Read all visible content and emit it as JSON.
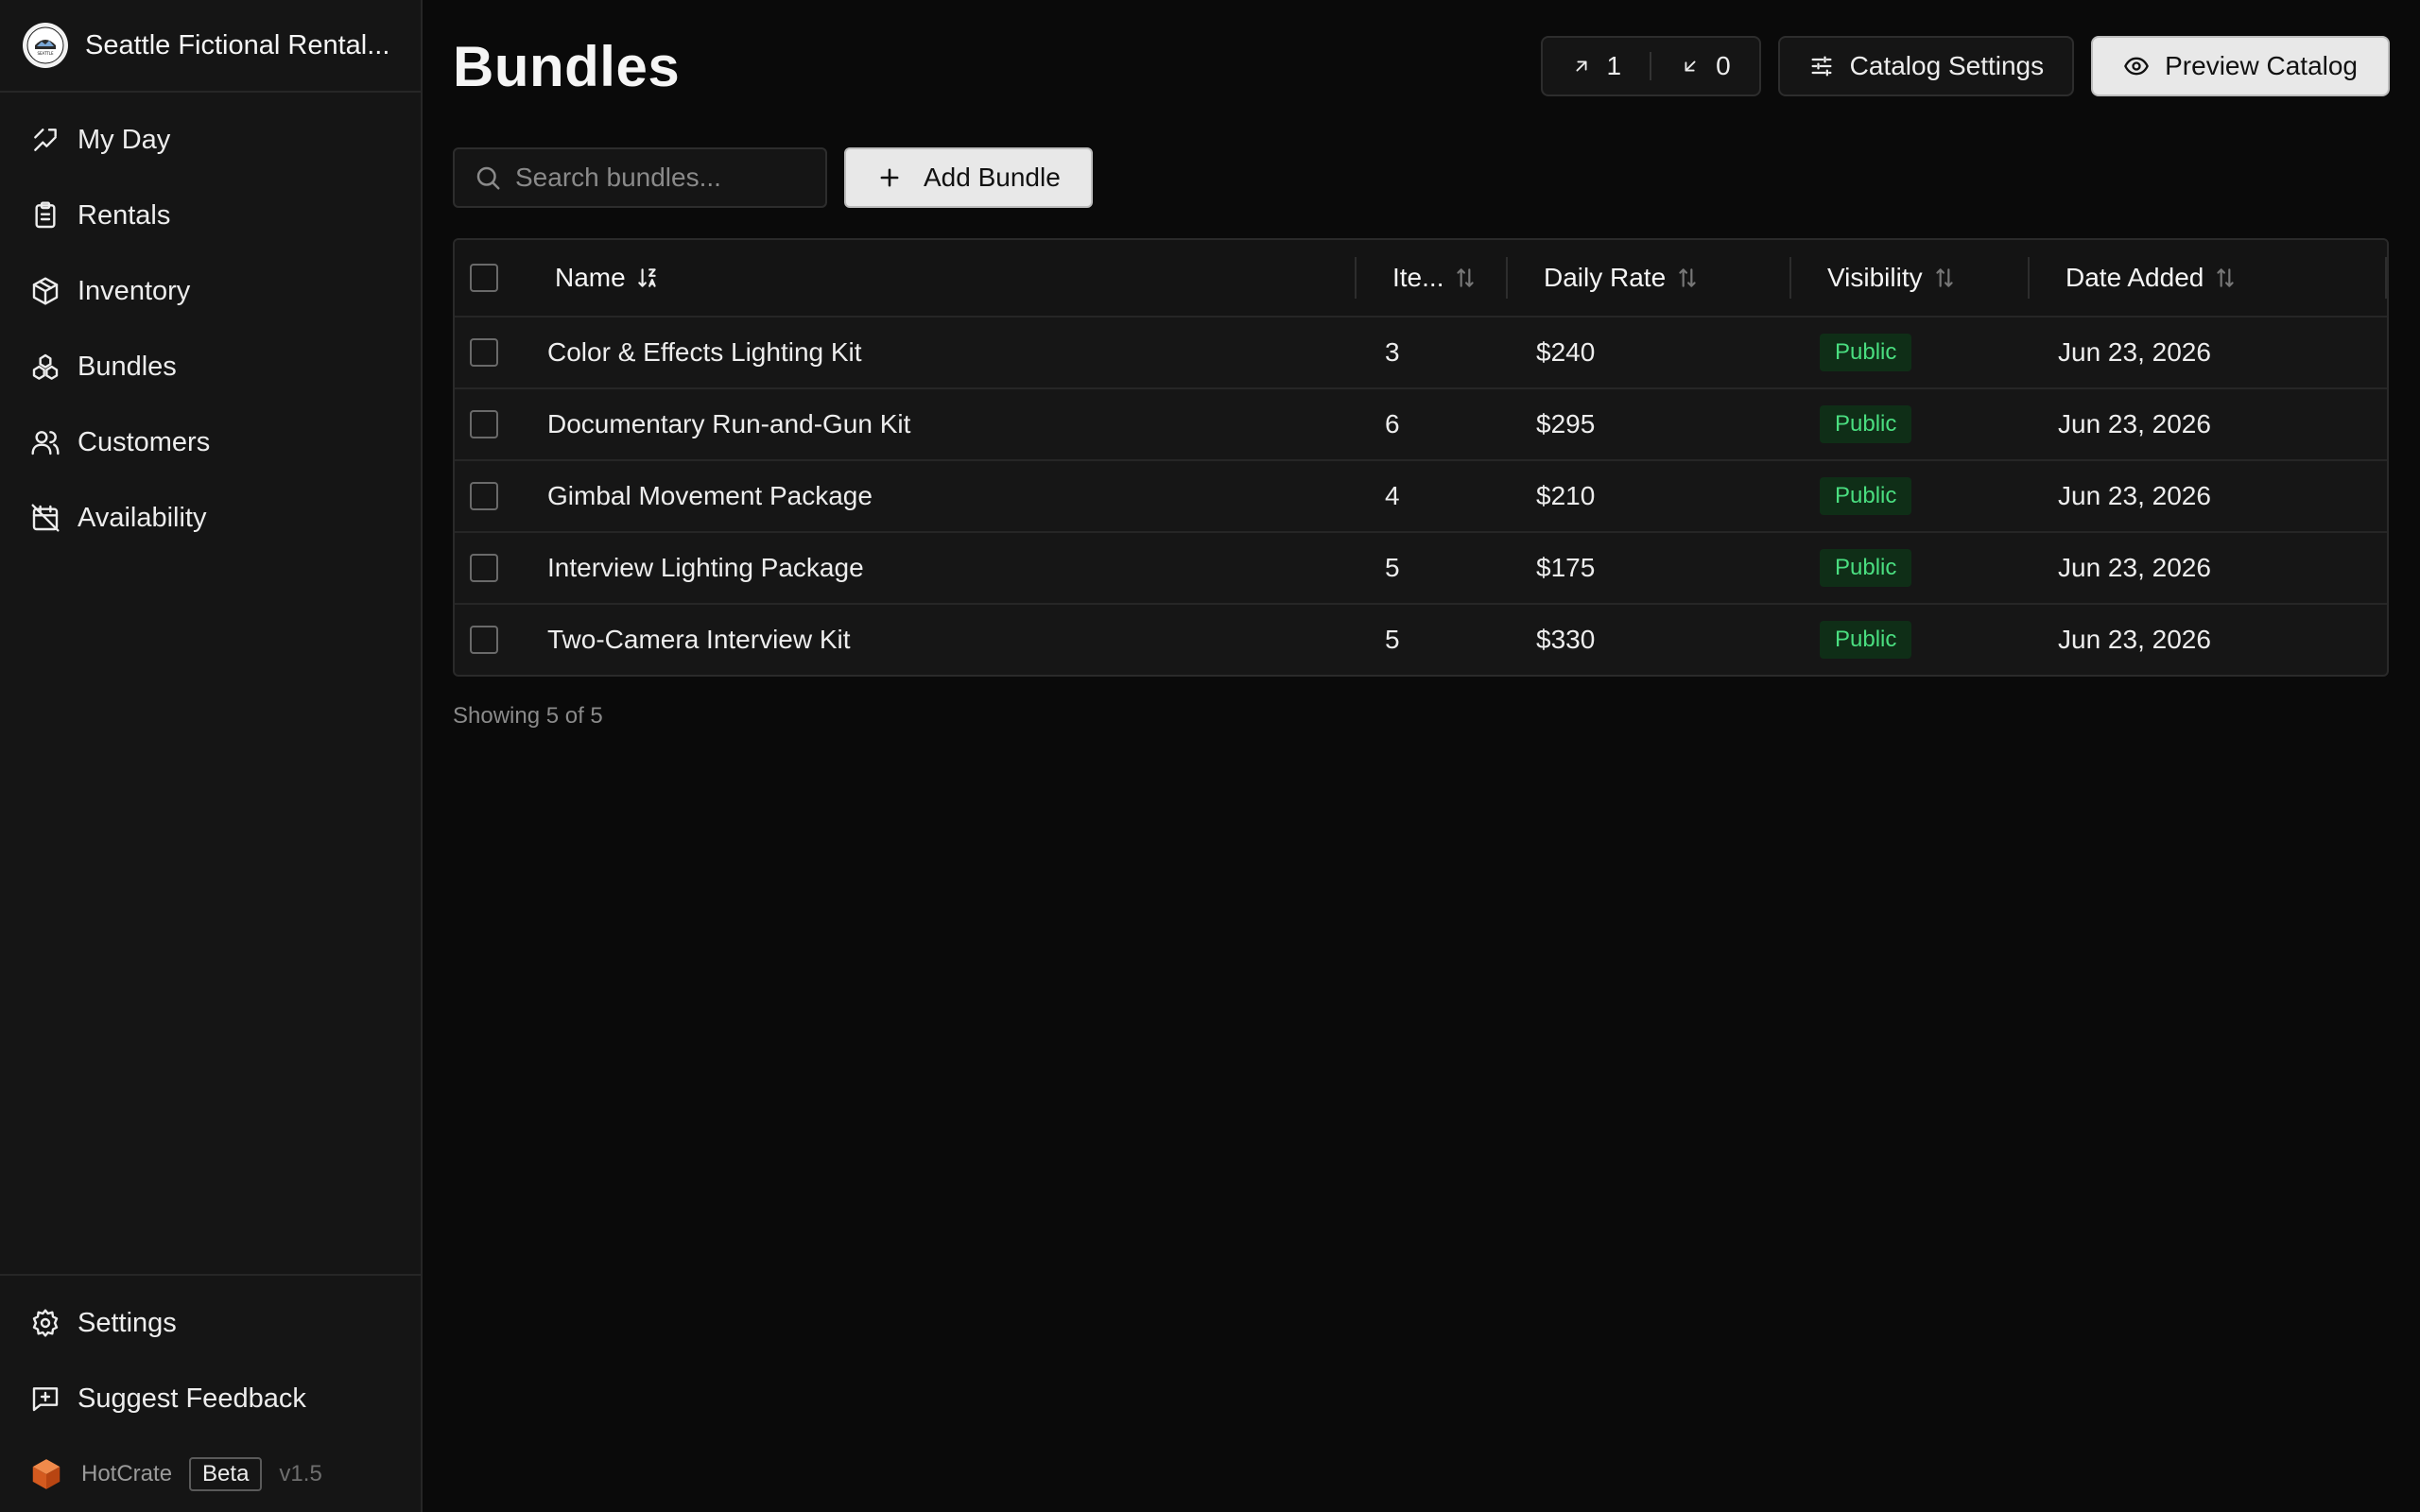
{
  "sidebar": {
    "brand_name": "Seattle Fictional Rental...",
    "logo_text": "SEATTLE",
    "nav": [
      {
        "label": "My Day",
        "icon": "my-day-icon"
      },
      {
        "label": "Rentals",
        "icon": "clipboard-icon"
      },
      {
        "label": "Inventory",
        "icon": "box-icon"
      },
      {
        "label": "Bundles",
        "icon": "bundles-icon"
      },
      {
        "label": "Customers",
        "icon": "users-icon"
      },
      {
        "label": "Availability",
        "icon": "calendar-off-icon"
      }
    ],
    "bottom": [
      {
        "label": "Settings",
        "icon": "gear-icon"
      },
      {
        "label": "Suggest Feedback",
        "icon": "feedback-icon"
      }
    ],
    "footer": {
      "app_name": "HotCrate",
      "beta": "Beta",
      "version": "v1.5"
    }
  },
  "header": {
    "title": "Bundles",
    "outgoing_count": "1",
    "incoming_count": "0",
    "catalog_settings": "Catalog Settings",
    "preview_catalog": "Preview Catalog"
  },
  "toolbar": {
    "search_placeholder": "Search bundles...",
    "add_bundle": "Add Bundle"
  },
  "table": {
    "columns": [
      "Name",
      "Ite...",
      "Daily Rate",
      "Visibility",
      "Date Added"
    ],
    "rows": [
      {
        "name": "Color & Effects Lighting Kit",
        "items": "3",
        "rate": "$240",
        "visibility": "Public",
        "date": "Jun 23, 2026"
      },
      {
        "name": "Documentary Run-and-Gun Kit",
        "items": "6",
        "rate": "$295",
        "visibility": "Public",
        "date": "Jun 23, 2026"
      },
      {
        "name": "Gimbal Movement Package",
        "items": "4",
        "rate": "$210",
        "visibility": "Public",
        "date": "Jun 23, 2026"
      },
      {
        "name": "Interview Lighting Package",
        "items": "5",
        "rate": "$175",
        "visibility": "Public",
        "date": "Jun 23, 2026"
      },
      {
        "name": "Two-Camera Interview Kit",
        "items": "5",
        "rate": "$330",
        "visibility": "Public",
        "date": "Jun 23, 2026"
      }
    ],
    "showing": "Showing 5 of 5"
  },
  "colors": {
    "background": "#0a0a0a",
    "sidebar": "#151515",
    "badge_bg": "#0f2e17",
    "badge_text": "#4ade80",
    "light_button": "#e8e8e8"
  }
}
